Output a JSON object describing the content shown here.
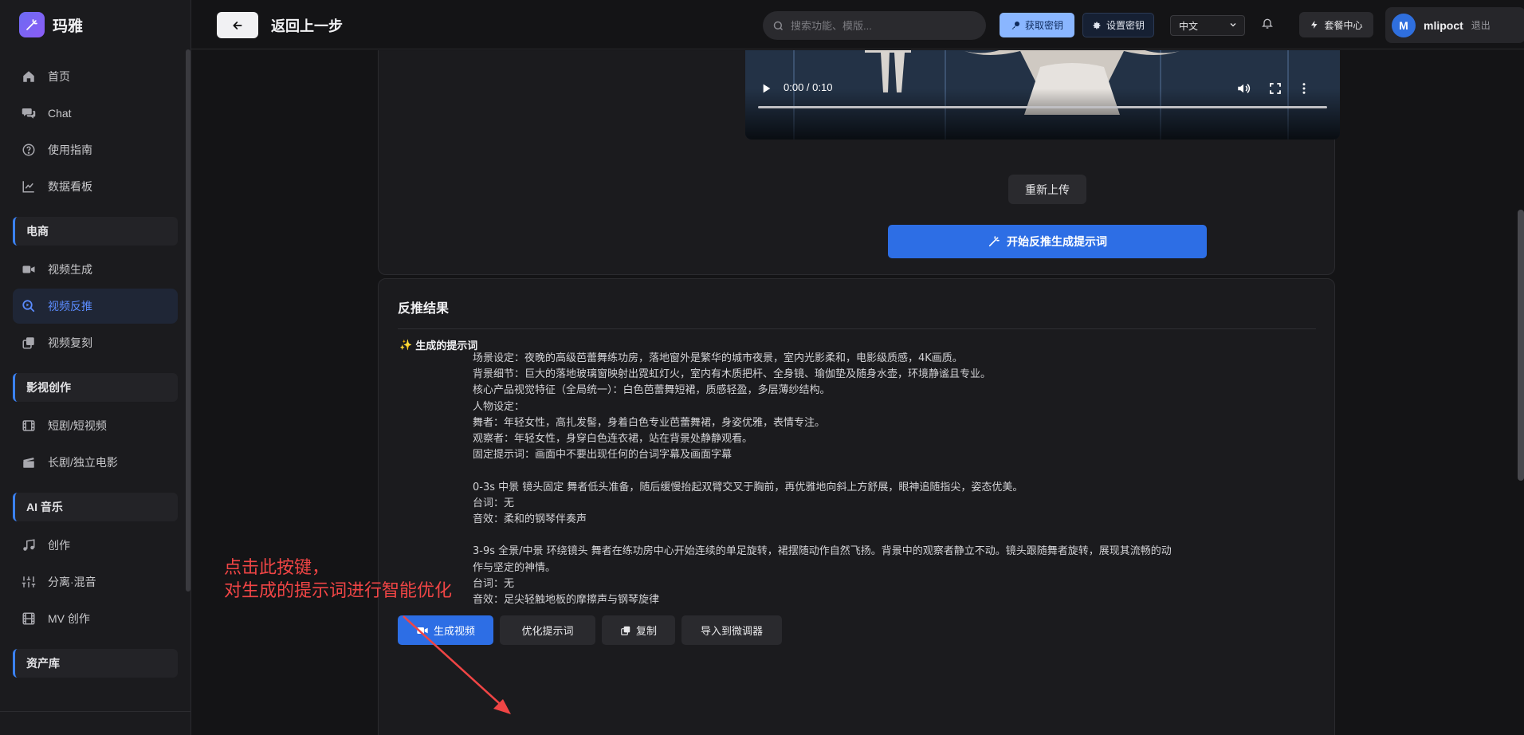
{
  "app": {
    "name": "玛雅"
  },
  "sidebar": {
    "items": [
      {
        "label": "首页",
        "icon": "home-icon"
      },
      {
        "label": "Chat",
        "icon": "chat-icon"
      },
      {
        "label": "使用指南",
        "icon": "help-circle-icon"
      },
      {
        "label": "数据看板",
        "icon": "chart-line-icon"
      }
    ],
    "sections": [
      {
        "title": "电商",
        "items": [
          {
            "label": "视频生成",
            "icon": "video-camera-icon"
          },
          {
            "label": "视频反推",
            "icon": "search-video-icon",
            "active": true
          },
          {
            "label": "视频复刻",
            "icon": "copy-stack-icon"
          }
        ]
      },
      {
        "title": "影视创作",
        "items": [
          {
            "label": "短剧/短视频",
            "icon": "film-icon"
          },
          {
            "label": "长剧/独立电影",
            "icon": "clapperboard-icon"
          }
        ]
      },
      {
        "title": "AI 音乐",
        "items": [
          {
            "label": "创作",
            "icon": "music-note-icon"
          },
          {
            "label": "分离·混音",
            "icon": "sliders-icon"
          },
          {
            "label": "MV 创作",
            "icon": "film-strip-icon"
          }
        ]
      },
      {
        "title": "资产库",
        "items": []
      }
    ]
  },
  "header": {
    "back_title": "返回上一步",
    "search_placeholder": "搜索功能、模版...",
    "get_key_label": "获取密钥",
    "set_key_label": "设置密钥",
    "language": "中文",
    "plan_label": "套餐中心",
    "user_initial": "M",
    "username": "mlipoct",
    "logout_label": "退出"
  },
  "video": {
    "time": "0:00 / 0:10",
    "progress": 0,
    "reupload_label": "重新上传",
    "start_label": "开始反推生成提示词"
  },
  "result": {
    "title": "反推结果",
    "generated_label": "生成的提示词",
    "lines": [
      "场景设定：夜晚的高级芭蕾舞练功房，落地窗外是繁华的城市夜景，室内光影柔和，电影级质感，4K画质。",
      "背景细节：巨大的落地玻璃窗映射出霓虹灯火，室内有木质把杆、全身镜、瑜伽垫及随身水壶，环境静谧且专业。",
      "核心产品视觉特征（全局统一）：白色芭蕾舞短裙，质感轻盈，多层薄纱结构。",
      "人物设定：",
      "舞者：年轻女性，高扎发髻，身着白色专业芭蕾舞裙，身姿优雅，表情专注。",
      "观察者：年轻女性，身穿白色连衣裙，站在背景处静静观看。",
      "固定提示词：画面中不要出现任何的台词字幕及画面字幕",
      "",
      "0-3s 中景 镜头固定 舞者低头准备，随后缓慢抬起双臂交叉于胸前，再优雅地向斜上方舒展，眼神追随指尖，姿态优美。",
      "台词：无",
      "音效：柔和的钢琴伴奏声",
      "",
      "3-9s 全景/中景 环绕镜头 舞者在练功房中心开始连续的单足旋转，裙摆随动作自然飞扬。背景中的观察者静立不动。镜头跟随舞者旋转，展现其流畅的动",
      "作与坚定的神情。",
      "台词：无",
      "音效：足尖轻触地板的摩擦声与钢琴旋律"
    ],
    "actions": {
      "generate_video": "生成视频",
      "optimize": "优化提示词",
      "copy": "复制",
      "import": "导入到微调器"
    }
  },
  "annotation": {
    "line1": "点击此按键，",
    "line2": "对生成的提示词进行智能优化",
    "color": "#f04545"
  }
}
